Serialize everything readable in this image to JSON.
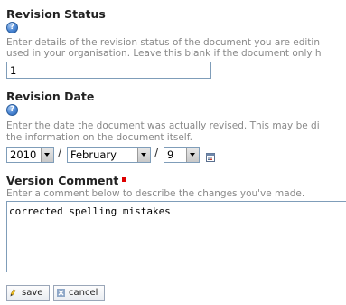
{
  "revision_status": {
    "label": "Revision Status",
    "help_icon": "question-mark-icon",
    "description_line1": "Enter details of the revision status of the document you are editin",
    "description_line2": "used in your organisation. Leave this blank if the document only h",
    "value": "1"
  },
  "revision_date": {
    "label": "Revision Date",
    "help_icon": "question-mark-icon",
    "description_line1": "Enter the date the document was actually revised. This may be di",
    "description_line2": "the information on the document itself.",
    "year": "2010",
    "separator1": "/",
    "month": "February",
    "separator2": "/",
    "day": "9",
    "calendar_icon": "calendar-icon"
  },
  "version_comment": {
    "label": "Version Comment",
    "required_marker_color": "#dd0000",
    "description": "Enter a comment below to describe the changes you've made.",
    "value": "corrected spelling mistakes"
  },
  "actions": {
    "save_label": "save",
    "save_icon": "save-icon",
    "cancel_label": "cancel",
    "cancel_icon": "cancel-icon"
  },
  "colors": {
    "label_text": "#222222",
    "description_text": "#888888",
    "input_border": "#7f9db9",
    "help_icon_blue": "#4a86d4"
  }
}
